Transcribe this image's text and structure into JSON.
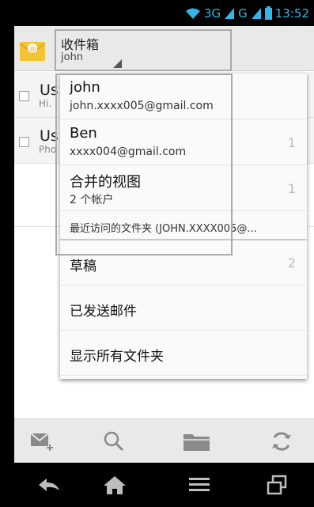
{
  "status_bar": {
    "network_3g": "3G",
    "network_g": "G",
    "time": "13:52"
  },
  "action_bar": {
    "mailbox_title": "收件箱",
    "account_name": "john"
  },
  "conversations": [
    {
      "sender": "Us",
      "snippet": "Hi."
    },
    {
      "sender": "Us",
      "snippet": "Pho"
    }
  ],
  "dropdown": {
    "accounts": [
      {
        "name": "john",
        "address": "john.xxxx005@gmail.com",
        "count": ""
      },
      {
        "name": "Ben",
        "address": "xxxx004@gmail.com",
        "count": "1"
      },
      {
        "name": "合并的视图",
        "address": "2 个帐户",
        "count": "1"
      }
    ],
    "recent_header": "最近访问的文件夹 (JOHN.XXXX005@...",
    "folders": [
      {
        "label": "草稿",
        "count": "2"
      },
      {
        "label": "已发送邮件",
        "count": ""
      },
      {
        "label": "显示所有文件夹",
        "count": ""
      }
    ]
  },
  "bottom_actions": [
    "compose-icon",
    "search-icon",
    "folder-icon",
    "refresh-icon"
  ],
  "nav_actions": [
    "back-icon",
    "home-icon",
    "menu-icon",
    "recent-apps-icon"
  ],
  "colors": {
    "status_blue": "#33b5e5",
    "bar_bg": "#e9e9e9"
  }
}
